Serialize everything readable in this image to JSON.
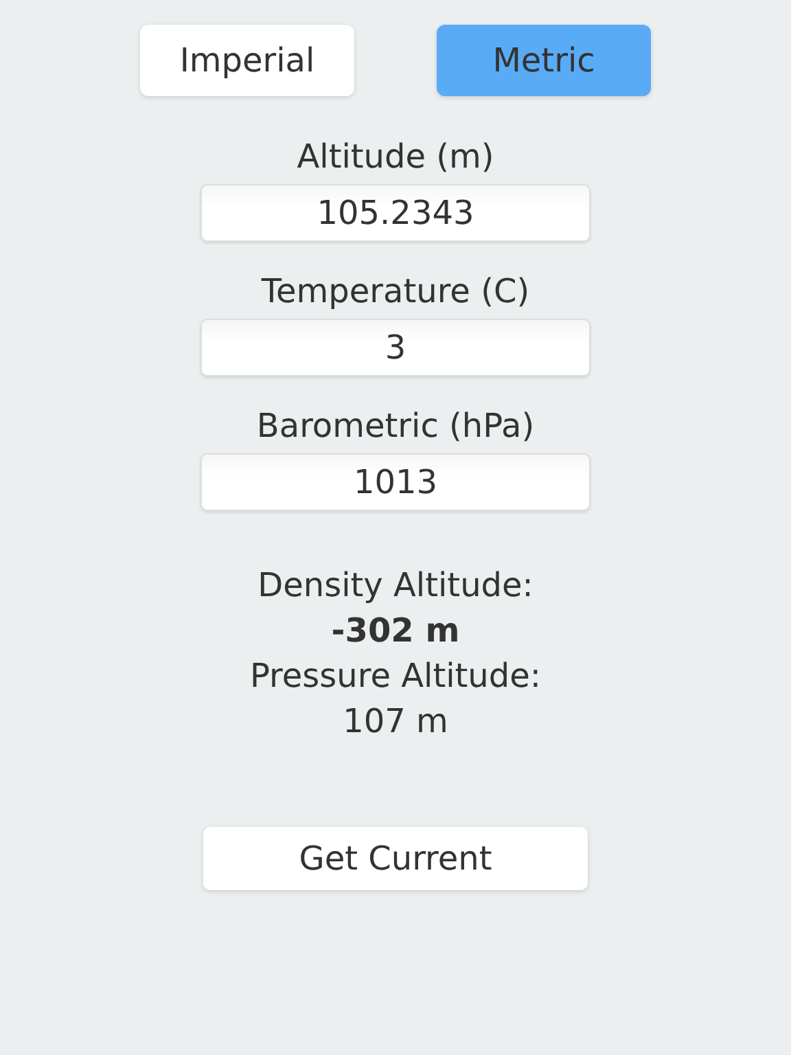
{
  "units": [
    {
      "label": "Imperial",
      "selected": false
    },
    {
      "label": "Metric",
      "selected": true
    }
  ],
  "fields": [
    {
      "label": "Altitude (m)",
      "value": "105.2343"
    },
    {
      "label": "Temperature (C)",
      "value": "3"
    },
    {
      "label": "Barometric (hPa)",
      "value": "1013"
    }
  ],
  "results": [
    {
      "label": "Density Altitude:",
      "value": "-302 m",
      "emphasized": true
    },
    {
      "label": "Pressure Altitude:",
      "value": "107 m",
      "emphasized": false
    }
  ],
  "action_button": "Get Current"
}
